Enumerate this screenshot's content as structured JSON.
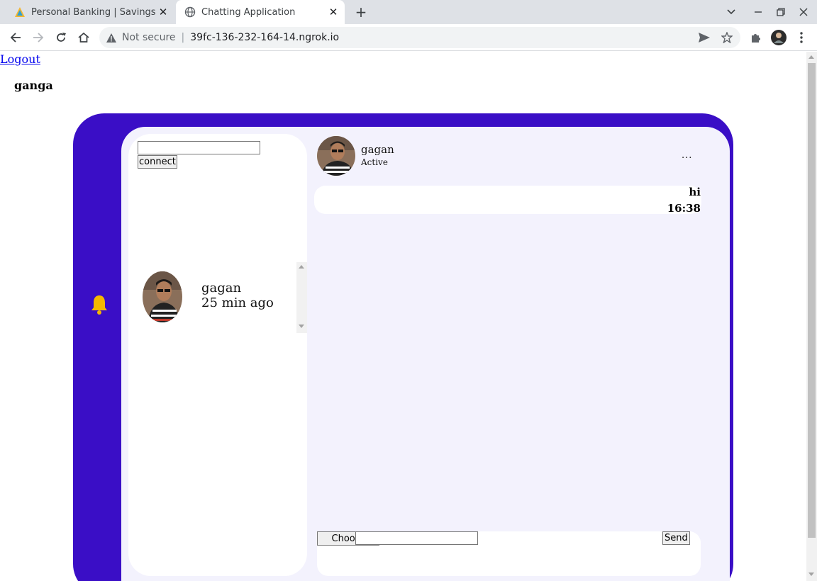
{
  "browser": {
    "tabs": [
      {
        "title": "Personal Banking | Savings A",
        "active": false
      },
      {
        "title": "Chatting Application",
        "active": true
      }
    ],
    "address": {
      "security_label": "Not secure",
      "url": "39fc-136-232-164-14.ngrok.io"
    }
  },
  "page": {
    "logout_label": "Logout",
    "current_user": "ganga",
    "connect": {
      "input_value": "",
      "button_label": "connect"
    },
    "contacts": [
      {
        "name": "gagan",
        "last_seen": "25 min ago"
      }
    ],
    "chat": {
      "name": "gagan",
      "status": "Active",
      "more_label": "...",
      "messages": [
        {
          "text": "hi",
          "time": "16:38"
        }
      ],
      "composer": {
        "choose_label": "Choose",
        "input_value": "",
        "send_label": "Send"
      }
    }
  },
  "colors": {
    "outer_panel": "#3a0ec6",
    "inner_panel": "#f3f2fd",
    "bell": "#f5b800",
    "link": "#0000ee"
  },
  "icons": {
    "notification": "bell-icon",
    "back": "arrow-left-icon",
    "forward": "arrow-right-icon",
    "reload": "reload-icon",
    "home": "home-icon",
    "warning": "warning-icon",
    "share": "send-icon",
    "bookmark": "star-icon",
    "extensions": "puzzle-icon",
    "menu": "kebab-icon"
  }
}
